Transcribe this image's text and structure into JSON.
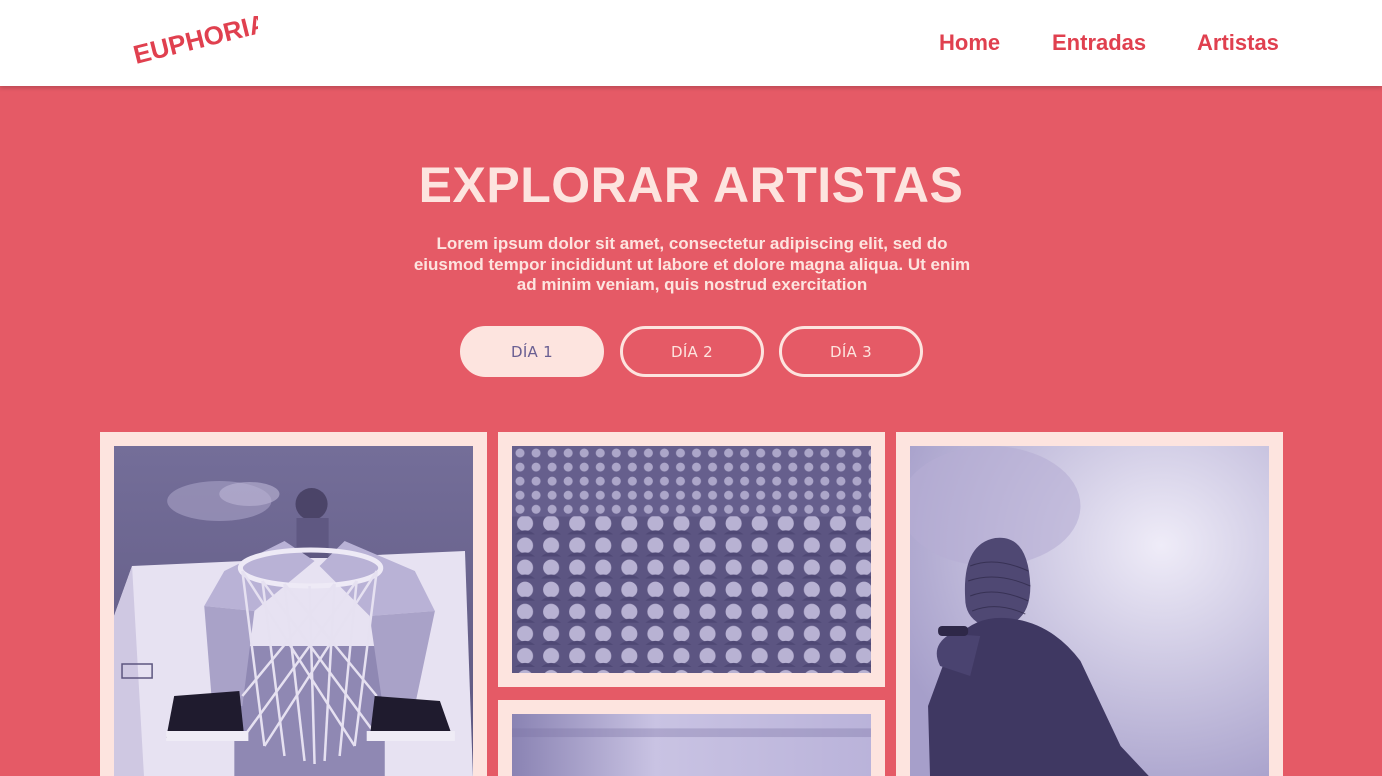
{
  "header": {
    "logo_text": "EUPHORIA",
    "nav": {
      "home": "Home",
      "entradas": "Entradas",
      "artistas": "Artistas"
    }
  },
  "hero": {
    "title": "EXPLORAR ARTISTAS",
    "description": "Lorem ipsum dolor sit amet, consectetur adipiscing elit, sed do eiusmod tempor incididunt ut labore et dolore magna aliqua.  Ut enim ad minim veniam, quis nostrud exercitation"
  },
  "days": [
    {
      "label": "DÍA 1",
      "active": true
    },
    {
      "label": "DÍA 2",
      "active": false
    },
    {
      "label": "DÍA 3",
      "active": false
    }
  ],
  "colors": {
    "background": "#e55a66",
    "accent_red": "#e0404f",
    "cream": "#fde4df",
    "duotone_purple": "#6a5f92"
  }
}
